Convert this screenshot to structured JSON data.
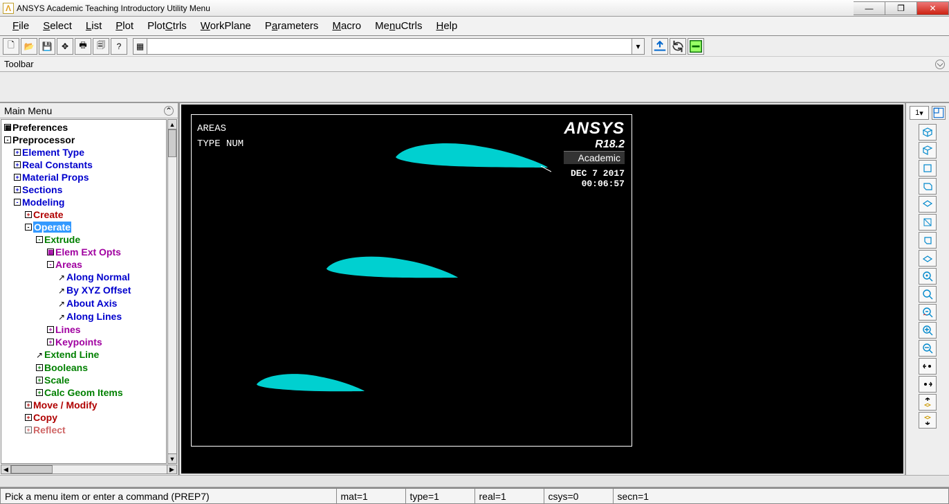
{
  "window": {
    "title": "ANSYS Academic Teaching Introductory Utility Menu"
  },
  "menubar": [
    "File",
    "Select",
    "List",
    "Plot",
    "PlotCtrls",
    "WorkPlane",
    "Parameters",
    "Macro",
    "MenuCtrls",
    "Help"
  ],
  "toolbar_label": "Toolbar",
  "left_panel": {
    "header": "Main Menu"
  },
  "tree": {
    "preferences": "Preferences",
    "preprocessor": "Preprocessor",
    "element_type": "Element Type",
    "real_constants": "Real Constants",
    "material_props": "Material Props",
    "sections": "Sections",
    "modeling": "Modeling",
    "create": "Create",
    "operate": "Operate",
    "extrude": "Extrude",
    "elem_ext_opts": "Elem Ext Opts",
    "areas": "Areas",
    "along_normal": "Along Normal",
    "by_xyz_offset": "By XYZ Offset",
    "about_axis": "About Axis",
    "along_lines": "Along Lines",
    "lines": "Lines",
    "keypoints": "Keypoints",
    "extend_line": "Extend Line",
    "booleans": "Booleans",
    "scale": "Scale",
    "calc_geom": "Calc Geom Items",
    "move_modify": "Move / Modify",
    "copy": "Copy",
    "reflect": "Reflect"
  },
  "viewport": {
    "label1": "AREAS",
    "label2": "TYPE NUM",
    "brand": "ANSYS",
    "version": "R18.2",
    "academic": "Academic",
    "date": "DEC  7 2017",
    "time": "00:06:57"
  },
  "right_dd": "1",
  "status": {
    "prompt": "Pick a menu item or enter a command (PREP7)",
    "mat": "mat=1",
    "type": "type=1",
    "real": "real=1",
    "csys": "csys=0",
    "secn": "secn=1"
  }
}
